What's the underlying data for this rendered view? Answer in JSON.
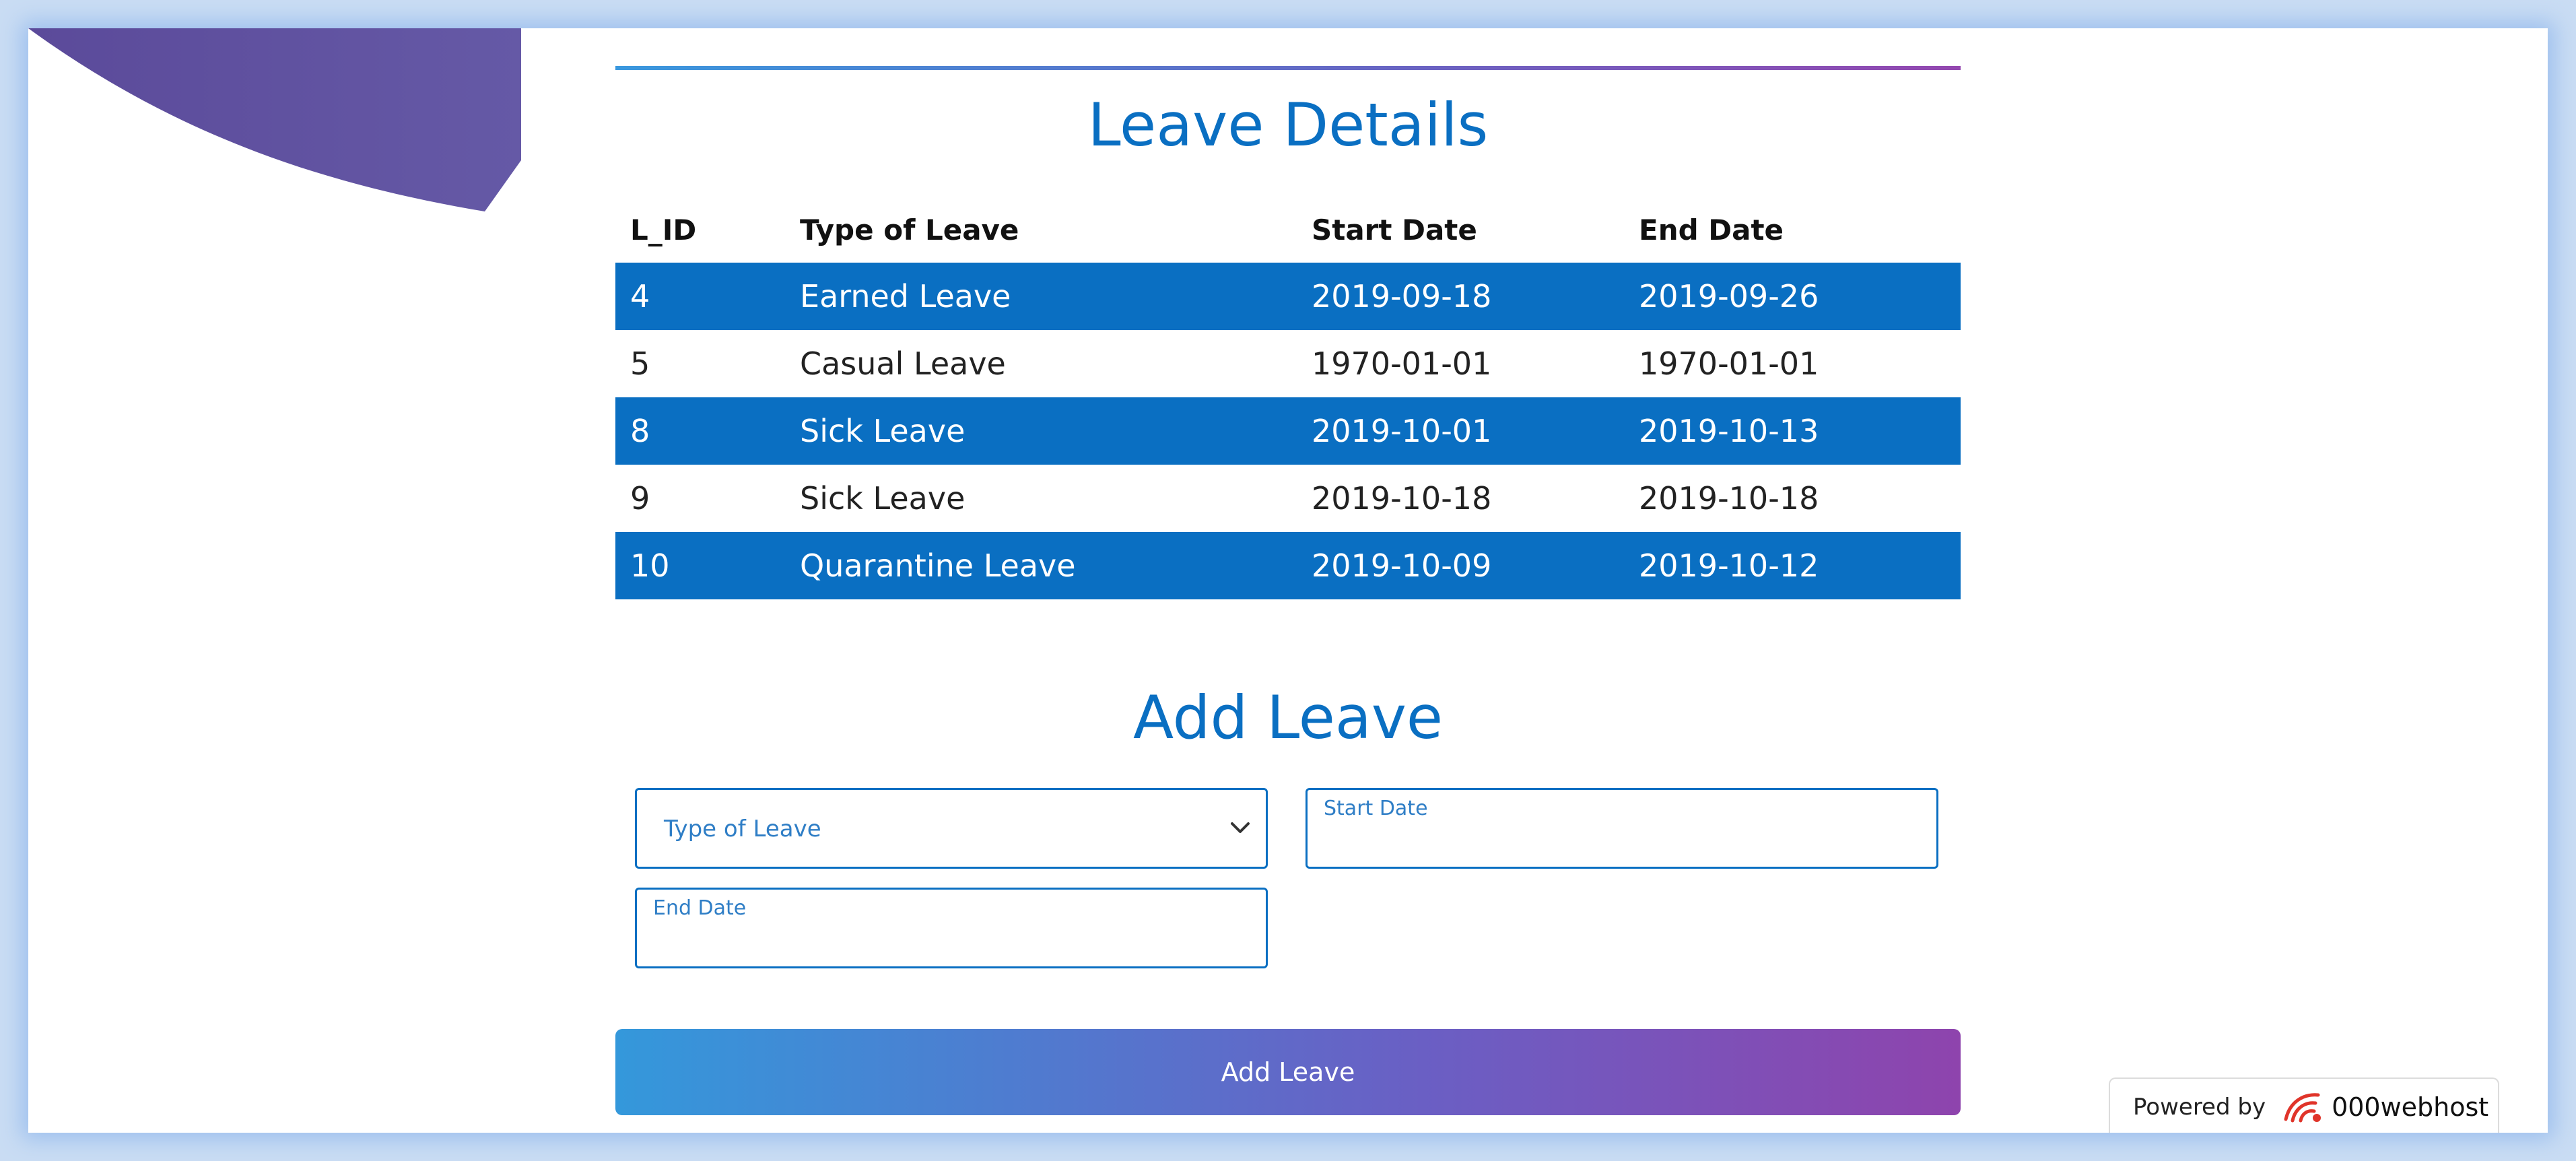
{
  "leave_details": {
    "title": "Leave Details",
    "columns": [
      "L_ID",
      "Type of Leave",
      "Start Date",
      "End Date"
    ],
    "rows": [
      [
        "4",
        "Earned Leave",
        "2019-09-18",
        "2019-09-26"
      ],
      [
        "5",
        "Casual Leave",
        "1970-01-01",
        "1970-01-01"
      ],
      [
        "8",
        "Sick Leave",
        "2019-10-01",
        "2019-10-13"
      ],
      [
        "9",
        "Sick Leave",
        "2019-10-18",
        "2019-10-18"
      ],
      [
        "10",
        "Quarantine Leave",
        "2019-10-09",
        "2019-10-12"
      ]
    ]
  },
  "add_leave": {
    "title": "Add Leave",
    "type_select": {
      "selected": "Type of Leave"
    },
    "start_date": {
      "label": "Start Date",
      "value": ""
    },
    "end_date": {
      "label": "End Date",
      "value": ""
    },
    "submit_label": "Add Leave"
  },
  "footer_badge": {
    "powered_by": "Powered by",
    "brand": "000webhost"
  },
  "colors": {
    "primary_blue": "#0a6fc2",
    "gradient_start": "#3498db",
    "gradient_end": "#8e44ad",
    "corner_purple": "#5e4f9e"
  }
}
